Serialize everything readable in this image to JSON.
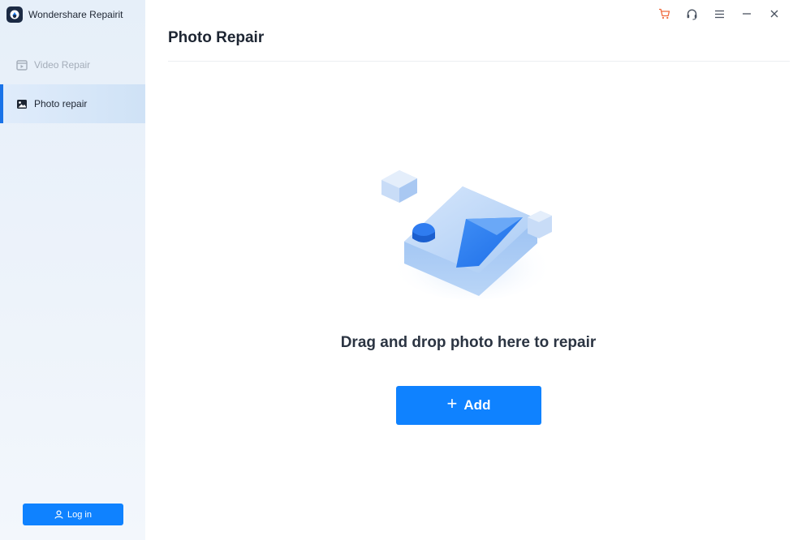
{
  "app": {
    "name": "Wondershare Repairit",
    "logo_icon": "repairit-logo-icon"
  },
  "sidebar": {
    "items": [
      {
        "label": "Video Repair",
        "icon": "video-icon",
        "active": false
      },
      {
        "label": "Photo repair",
        "icon": "image-icon",
        "active": true
      }
    ],
    "login_label": "Log in",
    "login_icon": "user-icon"
  },
  "titlebar": {
    "controls": [
      "cart-icon",
      "headset-icon",
      "menu-icon",
      "minimize-icon",
      "close-icon"
    ],
    "cart_color": "#f06a3d"
  },
  "main": {
    "title": "Photo Repair",
    "drop_text": "Drag and drop photo here to repair",
    "add_label": "Add",
    "add_icon": "plus-icon",
    "illustration": "photo-upload-illustration"
  },
  "colors": {
    "accent": "#0f82ff",
    "active_indicator": "#1a73e8",
    "sidebar_bg": "#e9f1fa"
  }
}
